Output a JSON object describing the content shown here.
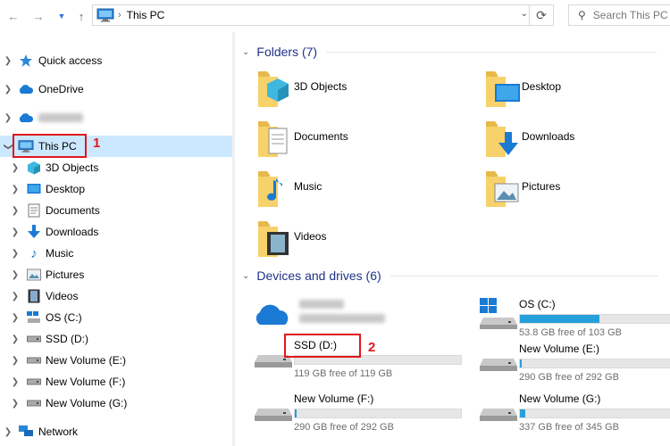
{
  "address": {
    "location": "This PC"
  },
  "search": {
    "placeholder": "Search This PC"
  },
  "nav": {
    "quick_access": "Quick access",
    "onedrive": "OneDrive",
    "this_pc": "This PC",
    "children": [
      "3D Objects",
      "Desktop",
      "Documents",
      "Downloads",
      "Music",
      "Pictures",
      "Videos",
      "OS (C:)",
      "SSD (D:)",
      "New Volume (E:)",
      "New Volume (F:)",
      "New Volume (G:)"
    ],
    "network": "Network"
  },
  "folders_header": "Folders (7)",
  "folders": [
    "3D Objects",
    "Desktop",
    "Documents",
    "Downloads",
    "Music",
    "Pictures",
    "Videos"
  ],
  "drives_header": "Devices and drives (6)",
  "drives": [
    {
      "name": "OS (C:)",
      "free": "53.8 GB free of 103 GB",
      "used_fraction": 0.48
    },
    {
      "name": "SSD (D:)",
      "free": "119 GB free of 119 GB",
      "used_fraction": 0.0
    },
    {
      "name": "New Volume (E:)",
      "free": "290 GB free of 292 GB",
      "used_fraction": 0.01
    },
    {
      "name": "New Volume (F:)",
      "free": "290 GB free of 292 GB",
      "used_fraction": 0.01
    },
    {
      "name": "New Volume (G:)",
      "free": "337 GB free of 345 GB",
      "used_fraction": 0.03
    }
  ],
  "annotations": {
    "one": "1",
    "two": "2"
  },
  "colors": {
    "accent": "#26a0da",
    "selected": "#cce8ff",
    "annotation": "#e0171d"
  }
}
